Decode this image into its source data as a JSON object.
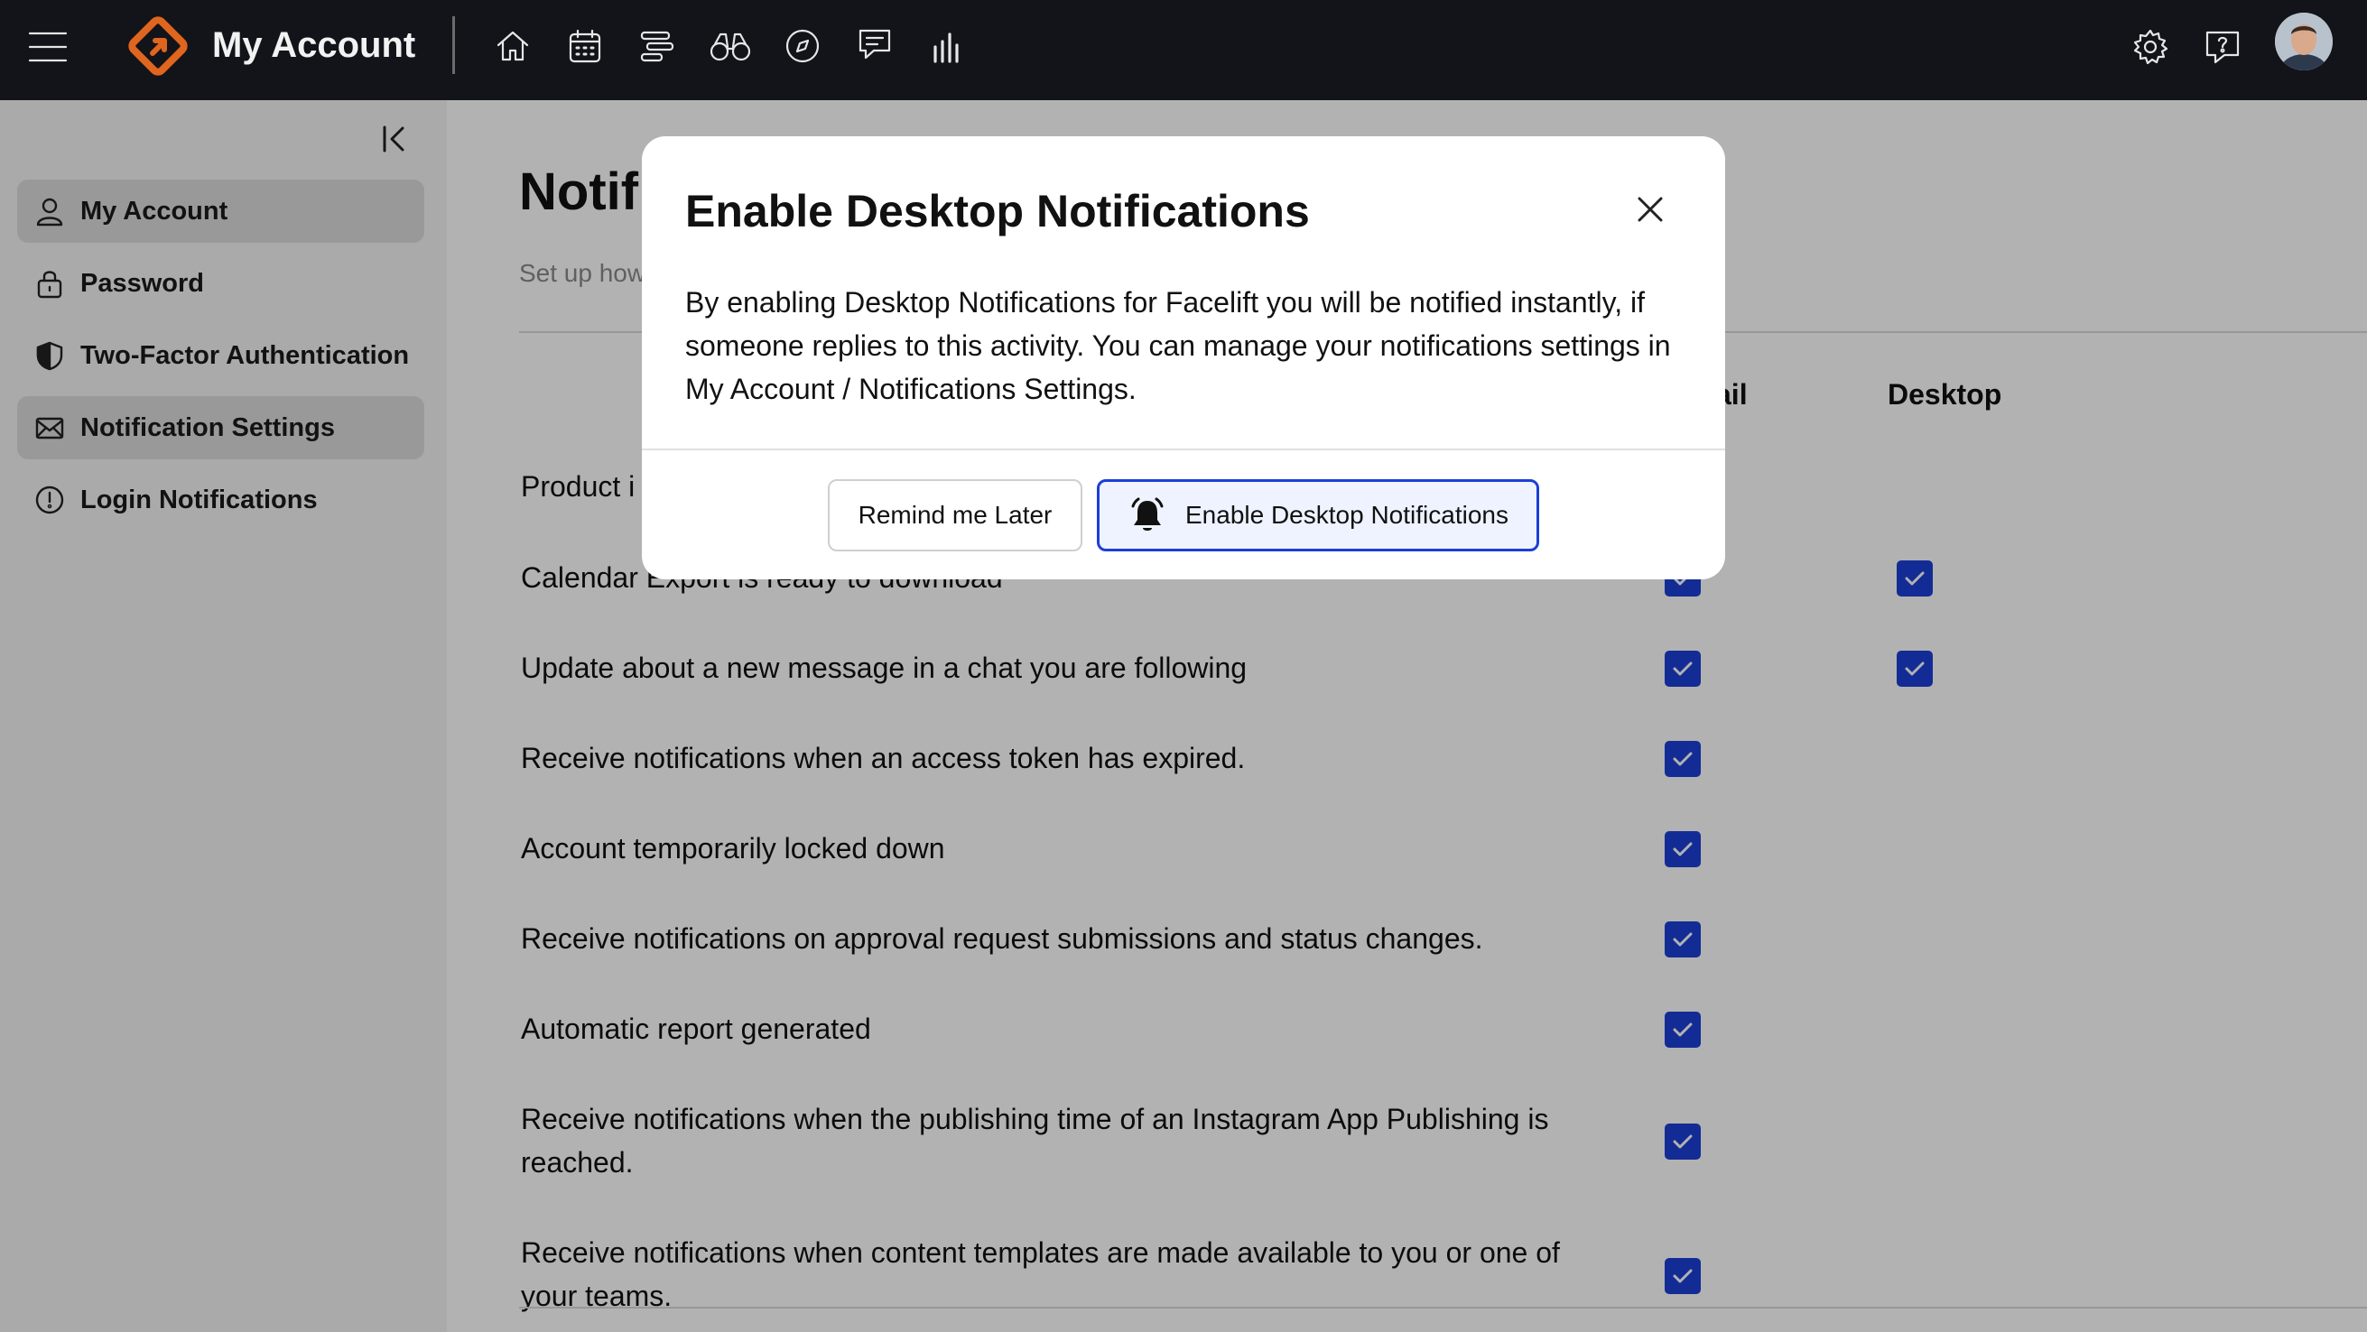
{
  "header": {
    "title": "My Account",
    "nav_icons": [
      "home-icon",
      "calendar-icon",
      "tasks-icon",
      "binoculars-icon",
      "compass-icon",
      "chat-icon",
      "analytics-icon"
    ],
    "right_icons": [
      "settings-icon",
      "help-icon",
      "avatar"
    ]
  },
  "sidebar": {
    "items": [
      {
        "label": "My Account",
        "icon": "user-icon",
        "active": true
      },
      {
        "label": "Password",
        "icon": "lock-icon",
        "active": false
      },
      {
        "label": "Two-Factor Authentication",
        "icon": "shield-icon",
        "active": false
      },
      {
        "label": "Notification Settings",
        "icon": "mail-icon",
        "active": true
      },
      {
        "label": "Login Notifications",
        "icon": "alert-circle-icon",
        "active": false
      }
    ]
  },
  "main": {
    "title_visible": "Notifi",
    "subtitle_visible": "Set up how",
    "columns": {
      "email_visible": "ail",
      "desktop": "Desktop"
    },
    "rows": [
      {
        "label": "Product i",
        "email": null,
        "desktop": null
      },
      {
        "label": "Calendar Export is ready to download",
        "email": true,
        "desktop": true
      },
      {
        "label": "Update about a new message in a chat you are following",
        "email": true,
        "desktop": true
      },
      {
        "label": "Receive notifications when an access token has expired.",
        "email": true,
        "desktop": false
      },
      {
        "label": "Account temporarily locked down",
        "email": true,
        "desktop": false
      },
      {
        "label": "Receive notifications on approval request submissions and status changes.",
        "email": true,
        "desktop": false
      },
      {
        "label": "Automatic report generated",
        "email": true,
        "desktop": false
      },
      {
        "label": "Receive notifications when the publishing time of an Instagram App Publishing is reached.",
        "email": true,
        "desktop": false
      },
      {
        "label": "Receive notifications when content templates are made available to you or one of your teams.",
        "email": true,
        "desktop": false
      }
    ]
  },
  "modal": {
    "title": "Enable Desktop Notifications",
    "body": "By enabling Desktop Notifications for Facelift you will be notified instantly, if someone replies to this activity. You can manage your notifications settings in My Account / Notifications Settings.",
    "secondary_button": "Remind me Later",
    "primary_button": "Enable Desktop Notifications"
  },
  "colors": {
    "topbar": "#12141a",
    "accent_logo": "#e0651e",
    "checkbox": "#1c3fd6",
    "sidebar_bg": "#f4f4f4",
    "active_item_bg": "#dcdcdc"
  }
}
